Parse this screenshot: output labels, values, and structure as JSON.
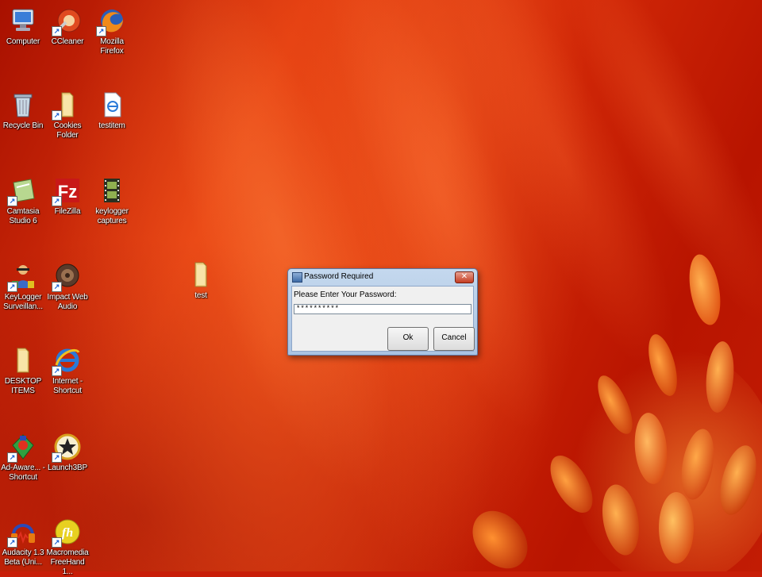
{
  "desktop_icons": [
    {
      "name": "computer-icon",
      "label": "Computer"
    },
    {
      "name": "ccleaner-icon",
      "label": "CCleaner"
    },
    {
      "name": "firefox-icon",
      "label": "Mozilla Firefox"
    },
    {
      "name": "recycle-bin-icon",
      "label": "Recycle Bin"
    },
    {
      "name": "folder-icon",
      "label": "Cookies Folder"
    },
    {
      "name": "text-document-icon",
      "label": "testitem"
    },
    {
      "name": "camtasia-icon",
      "label": "Camtasia Studio 6"
    },
    {
      "name": "filezilla-icon",
      "label": "FileZilla"
    },
    {
      "name": "film-icon",
      "label": "keylogger captures"
    },
    {
      "name": "keylogger-icon",
      "label": "KeyLogger Surveillan..."
    },
    {
      "name": "speaker-icon",
      "label": "Impact Web Audio"
    },
    {
      "name": "folder-icon",
      "label": "test"
    },
    {
      "name": "folder-icon",
      "label": "DESKTOP ITEMS"
    },
    {
      "name": "internet-explorer-icon",
      "label": "Internet - Shortcut"
    },
    {
      "name": "ad-aware-icon",
      "label": "Ad-Aware... - Shortcut"
    },
    {
      "name": "star-icon",
      "label": "Launch3BP"
    },
    {
      "name": "audacity-icon",
      "label": "Audacity 1.3 Beta (Uni..."
    },
    {
      "name": "macromedia-icon",
      "label": "Macromedia FreeHand 1..."
    }
  ],
  "dialog": {
    "title": "Password Required",
    "close_label": "✕",
    "prompt": "Please Enter Your Password:",
    "password_value": "**********",
    "ok_label": "Ok",
    "cancel_label": "Cancel"
  }
}
